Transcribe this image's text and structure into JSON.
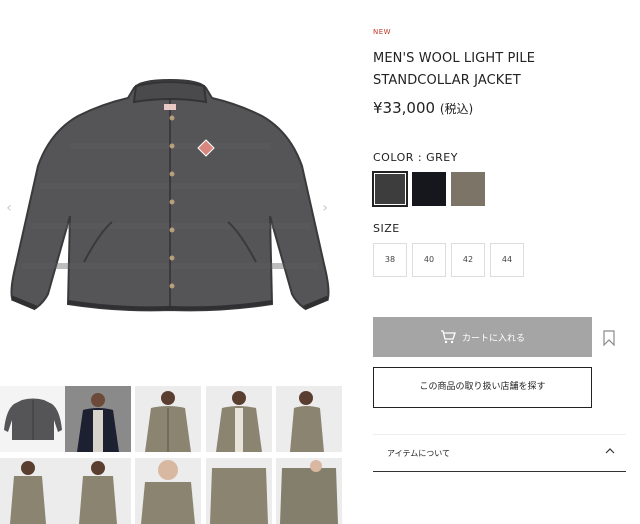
{
  "product": {
    "badge": "NEW",
    "title": "MEN'S WOOL LIGHT PILE STANDCOLLAR JACKET",
    "price": "¥33,000",
    "price_tax": "(税込)"
  },
  "gallery": {
    "prev_icon": "chevron-left-icon",
    "next_icon": "chevron-right-icon",
    "main_image": "grey-wool-jacket",
    "thumbnails": [
      "grey-jacket-flat",
      "navy-jacket-model",
      "khaki-jacket-model-front",
      "khaki-jacket-model-open",
      "khaki-jacket-model-side"
    ]
  },
  "color": {
    "label": "COLOR : GREY",
    "swatches": [
      {
        "name": "grey",
        "hex": "#3d3d3d",
        "selected": true
      },
      {
        "name": "navy",
        "hex": "#15171c",
        "selected": false
      },
      {
        "name": "khaki",
        "hex": "#7c7466",
        "selected": false
      }
    ]
  },
  "size": {
    "label": "SIZE",
    "options": [
      "38",
      "40",
      "42",
      "44"
    ]
  },
  "actions": {
    "cart_label": "カートに入れる",
    "cart_icon": "cart-icon",
    "bookmark_icon": "bookmark-icon",
    "store_label": "この商品の取り扱い店舗を探す"
  },
  "accordion": {
    "label": "アイテムについて",
    "icon": "chevron-up-icon"
  }
}
